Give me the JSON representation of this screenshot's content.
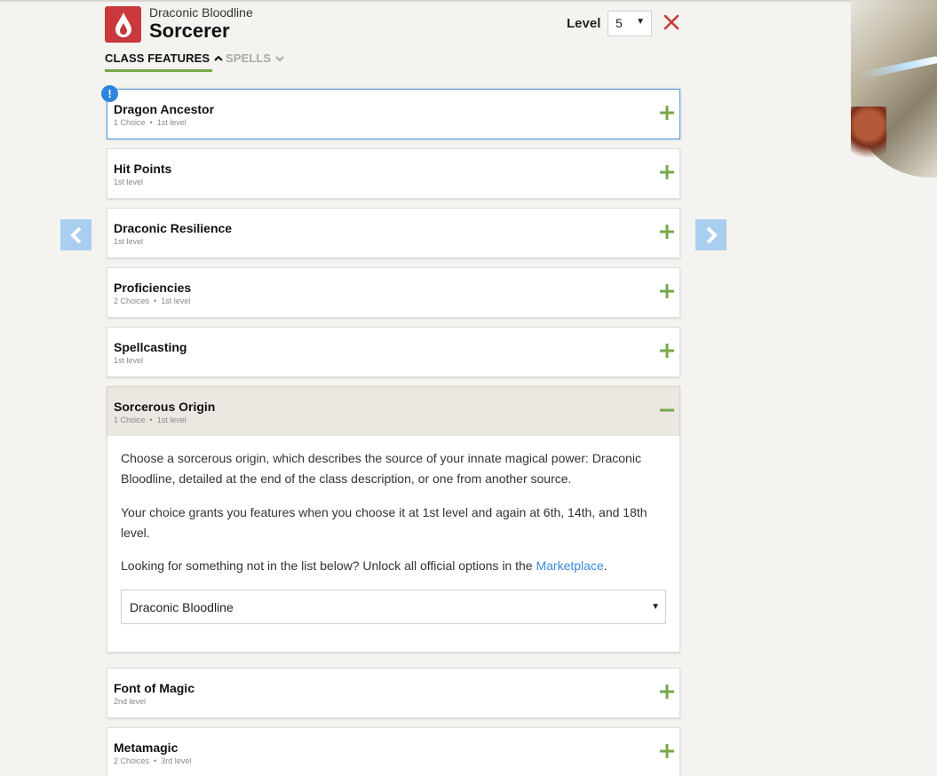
{
  "header": {
    "subclass": "Draconic Bloodline",
    "class_name": "Sorcerer",
    "level_label": "Level",
    "level_value": "5"
  },
  "tabs": [
    {
      "label": "CLASS FEATURES",
      "active": true
    },
    {
      "label": "SPELLS",
      "active": false
    }
  ],
  "features": [
    {
      "name": "Dragon Ancestor",
      "choices": "1 Choice",
      "level": "1st level",
      "alert": "!"
    },
    {
      "name": "Hit Points",
      "choices": "",
      "level": "1st level"
    },
    {
      "name": "Draconic Resilience",
      "choices": "",
      "level": "1st level"
    },
    {
      "name": "Proficiencies",
      "choices": "2 Choices",
      "level": "1st level"
    },
    {
      "name": "Spellcasting",
      "choices": "",
      "level": "1st level"
    },
    {
      "name": "Sorcerous Origin",
      "choices": "1 Choice",
      "level": "1st level",
      "expanded": true
    },
    {
      "name": "Font of Magic",
      "choices": "",
      "level": "2nd level"
    },
    {
      "name": "Metamagic",
      "choices": "2 Choices",
      "level": "3rd level"
    }
  ],
  "detail": {
    "paragraph1": "Choose a sorcerous origin, which describes the source of your innate magical power: Draconic Bloodline, detailed at the end of the class description, or one from another source.",
    "paragraph2": "Your choice grants you features when you choose it at 1st level and again at 6th, 14th, and 18th level.",
    "paragraph3_prefix": "Looking for something not in the list below? Unlock all official options in the ",
    "paragraph3_link": "Marketplace",
    "paragraph3_suffix": ".",
    "selected_origin": "Draconic Bloodline"
  },
  "colors": {
    "accent_green": "#76a94a",
    "close_red": "#c8383d",
    "alert_blue": "#2c86de",
    "link_blue": "#3b8ad9",
    "nav_arrow_bg": "#a9cef0"
  },
  "icons": {
    "class_icon": "flame-drop-icon",
    "close": "close-icon",
    "expand": "plus-icon",
    "collapse": "minus-icon",
    "prev": "chevron-left-icon",
    "next": "chevron-right-icon"
  }
}
